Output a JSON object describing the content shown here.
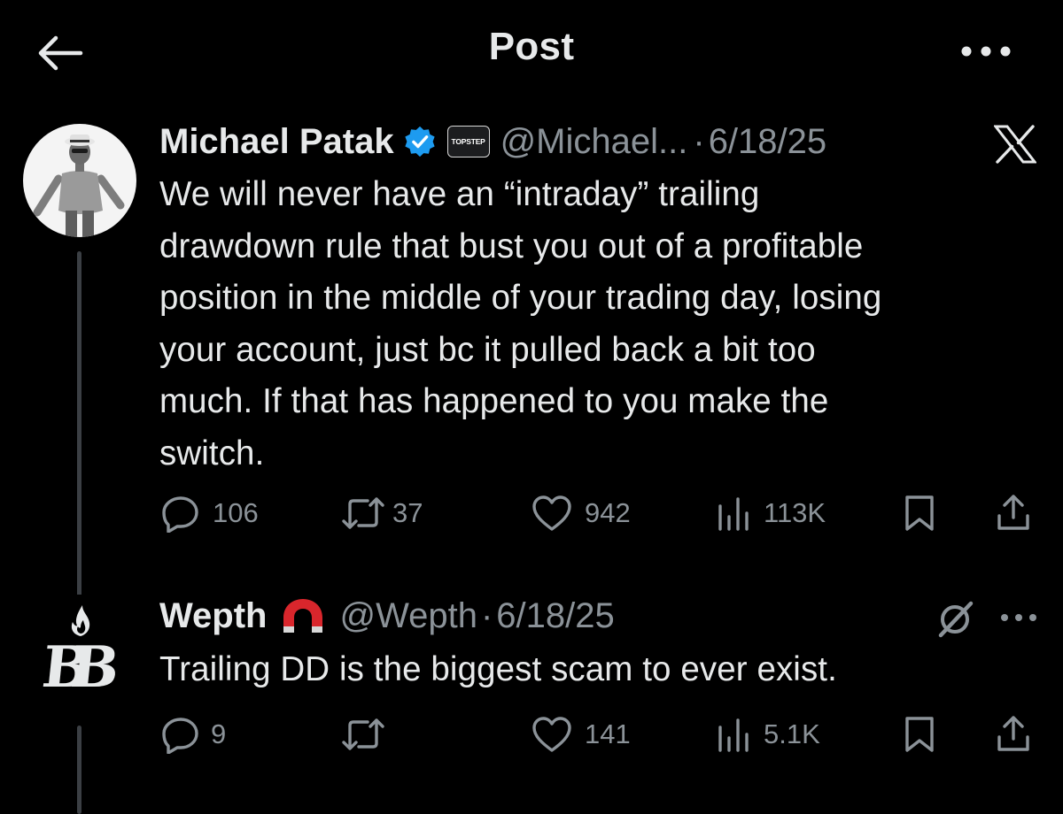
{
  "header": {
    "title": "Post",
    "back_icon": "arrow-left-icon",
    "more_icon": "more-horizontal-icon"
  },
  "main_post": {
    "display_name": "Michael Patak",
    "verified_icon": "verified-badge-icon",
    "affiliate_label": "TOPSTEP",
    "handle": "@Michael...",
    "separator": "·",
    "date": "6/18/25",
    "source_icon": "x-logo-icon",
    "text": "We will never have an “intraday” trailing\ndrawdown rule that bust you out of a profitable\nposition in the middle of your trading day, losing\nyour account, just bc it pulled back a bit too\nmuch. If that has happened to you make the\nswitch.",
    "stats": {
      "replies": "106",
      "reposts": "37",
      "likes": "942",
      "views": "113K"
    }
  },
  "reply_post": {
    "display_name": "Wepth",
    "name_emoji_icon": "magnet-emoji-icon",
    "avatar_logo_text": "BB",
    "handle": "@Wepth",
    "separator": "·",
    "date": "6/18/25",
    "grok_icon": "grok-icon",
    "more_icon": "more-horizontal-icon",
    "text": "Trailing DD is the biggest scam to ever exist.",
    "stats": {
      "replies": "9",
      "reposts": "",
      "likes": "141",
      "views": "5.1K"
    }
  },
  "colors": {
    "background": "#000000",
    "text_primary": "#e7e9ea",
    "text_secondary": "#8b9298",
    "verified_blue": "#1d9bf0",
    "thread_line": "#3b3f44"
  }
}
